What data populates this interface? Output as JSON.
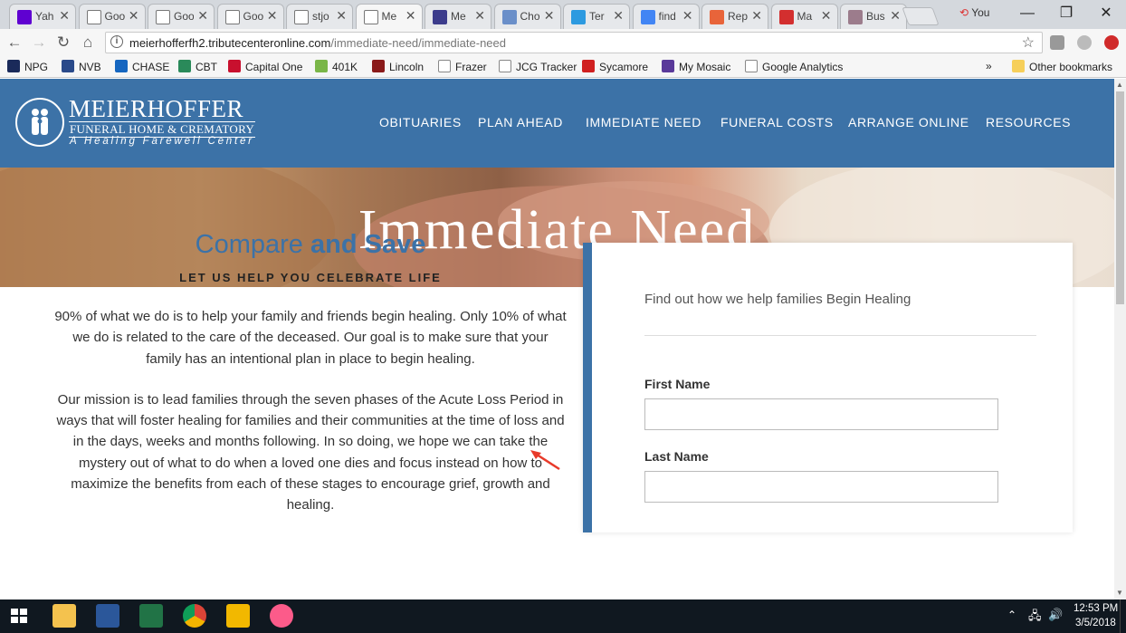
{
  "browser": {
    "tabs": [
      {
        "title": "Yah",
        "icon": "yahoo-icon",
        "color": "#5f01d1",
        "active": false
      },
      {
        "title": "Goo",
        "icon": "page-icon",
        "color": "#ffffff",
        "active": false
      },
      {
        "title": "Goo",
        "icon": "page-icon",
        "color": "#ffffff",
        "active": false
      },
      {
        "title": "Goo",
        "icon": "page-icon",
        "color": "#ffffff",
        "active": false
      },
      {
        "title": "stjo",
        "icon": "page-icon",
        "color": "#ffffff",
        "active": false
      },
      {
        "title": "Me",
        "icon": "page-icon",
        "color": "#ffffff",
        "active": true
      },
      {
        "title": "Me",
        "icon": "site-icon",
        "color": "#3c3c8c",
        "active": false
      },
      {
        "title": "Cho",
        "icon": "bird-icon",
        "color": "#6a8fc9",
        "active": false
      },
      {
        "title": "Ter",
        "icon": "d-icon",
        "color": "#2d9ae0",
        "active": false
      },
      {
        "title": "find",
        "icon": "google-icon",
        "color": "#4285f4",
        "active": false
      },
      {
        "title": "Rep",
        "icon": "orange-icon",
        "color": "#e8643a",
        "active": false
      },
      {
        "title": "Ma",
        "icon": "mail-icon",
        "color": "#d32f2f",
        "active": false
      },
      {
        "title": "Bus",
        "icon": "bus-icon",
        "color": "#9c7c8c",
        "active": false
      }
    ],
    "profile_label": "You",
    "window_controls": {
      "minimize": "—",
      "restore": "❐",
      "close": "✕"
    },
    "url_domain": "meierhofferfh2.tributecenteronline.com",
    "url_path": "/immediate-need/immediate-need",
    "bookmarks": [
      {
        "label": "NPG",
        "icon": "npg-icon",
        "color": "#1a2a5a"
      },
      {
        "label": "NVB",
        "icon": "nvb-icon",
        "color": "#2a4a8a"
      },
      {
        "label": "CHASE",
        "icon": "chase-icon",
        "color": "#1566c0"
      },
      {
        "label": "CBT",
        "icon": "cbt-icon",
        "color": "#2a8a5a"
      },
      {
        "label": "Capital One",
        "icon": "capital-one-icon",
        "color": "#c8102e"
      },
      {
        "label": "401K",
        "icon": "jh-icon",
        "color": "#7ab648"
      },
      {
        "label": "Lincoln",
        "icon": "lincoln-icon",
        "color": "#8a1a1a"
      },
      {
        "label": "Frazer",
        "icon": "page-icon",
        "color": "#ffffff"
      },
      {
        "label": "JCG Tracker",
        "icon": "page-icon",
        "color": "#ffffff"
      },
      {
        "label": "Sycamore",
        "icon": "leaf-icon",
        "color": "#d02020"
      },
      {
        "label": "My Mosaic",
        "icon": "mosaic-icon",
        "color": "#5a3a9a"
      },
      {
        "label": "Google Analytics",
        "icon": "google-icon",
        "color": "#ffffff"
      }
    ],
    "more_bookmarks": "»",
    "other_bookmarks": "Other bookmarks"
  },
  "site": {
    "logo_name": "MEIERHOFFER",
    "logo_sub": "FUNERAL HOME & CREMATORY",
    "logo_tag": "A Healing Farewell Center",
    "nav": [
      "OBITUARIES",
      "PLAN AHEAD",
      "IMMEDIATE NEED",
      "FUNERAL COSTS",
      "ARRANGE ONLINE",
      "RESOURCES"
    ],
    "hero_title": "Immediate Need",
    "compare_a": "Compare",
    "compare_b": "and Save",
    "subheading": "LET US HELP YOU CELEBRATE LIFE",
    "para1": "90% of what we do is to help your family and friends begin healing. Only 10% of what we do is related to the care of the deceased. Our goal is to make sure that your family has an intentional plan in place to begin healing.",
    "para2": "Our mission is to lead families through the seven phases of the Acute Loss Period in ways that will foster healing for families and their communities at the time of loss and in the days, weeks and months following. In so doing, we hope we can take the mystery out of what to do when a loved one dies and focus instead on how to maximize the benefits from each of these stages to encourage grief, growth and healing.",
    "form_intro": "Find out how we help families Begin Healing",
    "first_name_label": "First Name",
    "last_name_label": "Last Name",
    "accent_color": "#3c72a7"
  },
  "taskbar": {
    "time": "12:53 PM",
    "date": "3/5/2018",
    "apps": [
      "windows-start-icon",
      "file-explorer-icon",
      "word-icon",
      "excel-icon",
      "chrome-icon",
      "outlook-icon",
      "itunes-icon"
    ]
  }
}
